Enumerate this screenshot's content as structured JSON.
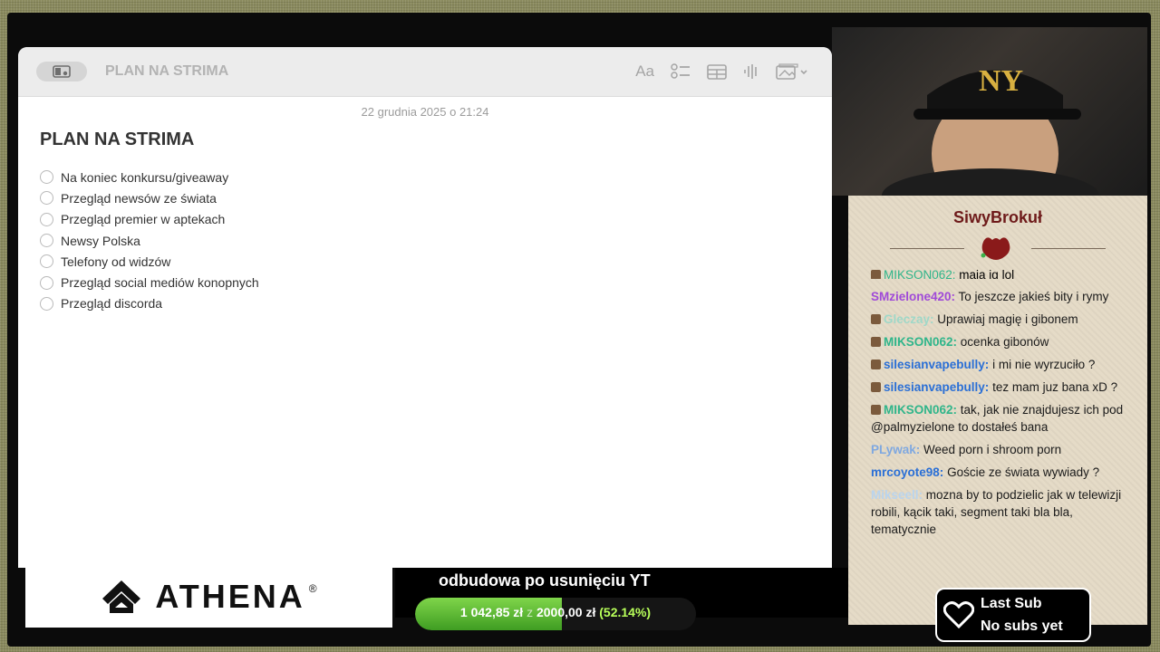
{
  "notes": {
    "toolbar_title": "PLAN NA STRIMA",
    "format_label": "Aa",
    "date": "22 grudnia 2025 o 21:24",
    "title": "PLAN NA STRIMA",
    "checklist": [
      "Na koniec konkursu/giveaway",
      "Przegląd newsów ze świata",
      "Przegląd premier w aptekach",
      "Newsy Polska",
      "Telefony od widzów",
      "Przegląd social mediów konopnych",
      "Przegląd discorda"
    ]
  },
  "chat": {
    "brand": "SiwyBrokuł",
    "clipped_message": {
      "user": "MIKSON062:",
      "text": "mają ig lol"
    },
    "messages": [
      {
        "user": "SMzielone420:",
        "text": "To jeszcze jakieś bity i rymy",
        "color": "#a04ad8",
        "badge": false
      },
      {
        "user": "Gleczay:",
        "text": "Uprawiaj magię i gibonem",
        "color": "#9fd8c8",
        "badge": true
      },
      {
        "user": "MIKSON062:",
        "text": "ocenka gibonów",
        "color": "#2fb58a",
        "badge": true
      },
      {
        "user": "silesianvapebully:",
        "text": "i mi nie wyrzuciło ?",
        "color": "#2a6fd6",
        "badge": true
      },
      {
        "user": "silesianvapebully:",
        "text": "tez mam juz bana xD ?",
        "color": "#2a6fd6",
        "badge": true
      },
      {
        "user": "MIKSON062:",
        "text": "tak, jak nie znajdujesz ich pod @palmyzielone to dostałeś bana",
        "color": "#2fb58a",
        "badge": true
      },
      {
        "user": "PLywak:",
        "text": "Weed porn i shroom porn",
        "color": "#7fa8e0",
        "badge": false
      },
      {
        "user": "mrcoyote98:",
        "text": "Goście ze świata wywiady ?",
        "color": "#2a6fd6",
        "badge": false
      },
      {
        "user": "Mikseell:",
        "text": "mozna by to podzielic jak w telewizji robili, kącik taki, segment taki bla bla, tematycznie",
        "color": "#b9d4ee",
        "badge": false
      }
    ]
  },
  "sponsor": {
    "name": "ATHENA",
    "mark": "®"
  },
  "goal": {
    "title": "odbudowa po usunięciu YT",
    "current": "1 042,85 zł",
    "separator": "z",
    "target": "2000,00 zł",
    "percent_label": "(52.14%)",
    "progress": 0.5214
  },
  "last_sub": {
    "title": "Last Sub",
    "value": "No subs yet"
  },
  "colors": {
    "brand": "#6e1a1a",
    "goal_fill": "#5cbf33",
    "chat_bg": "#e5dbc7"
  }
}
